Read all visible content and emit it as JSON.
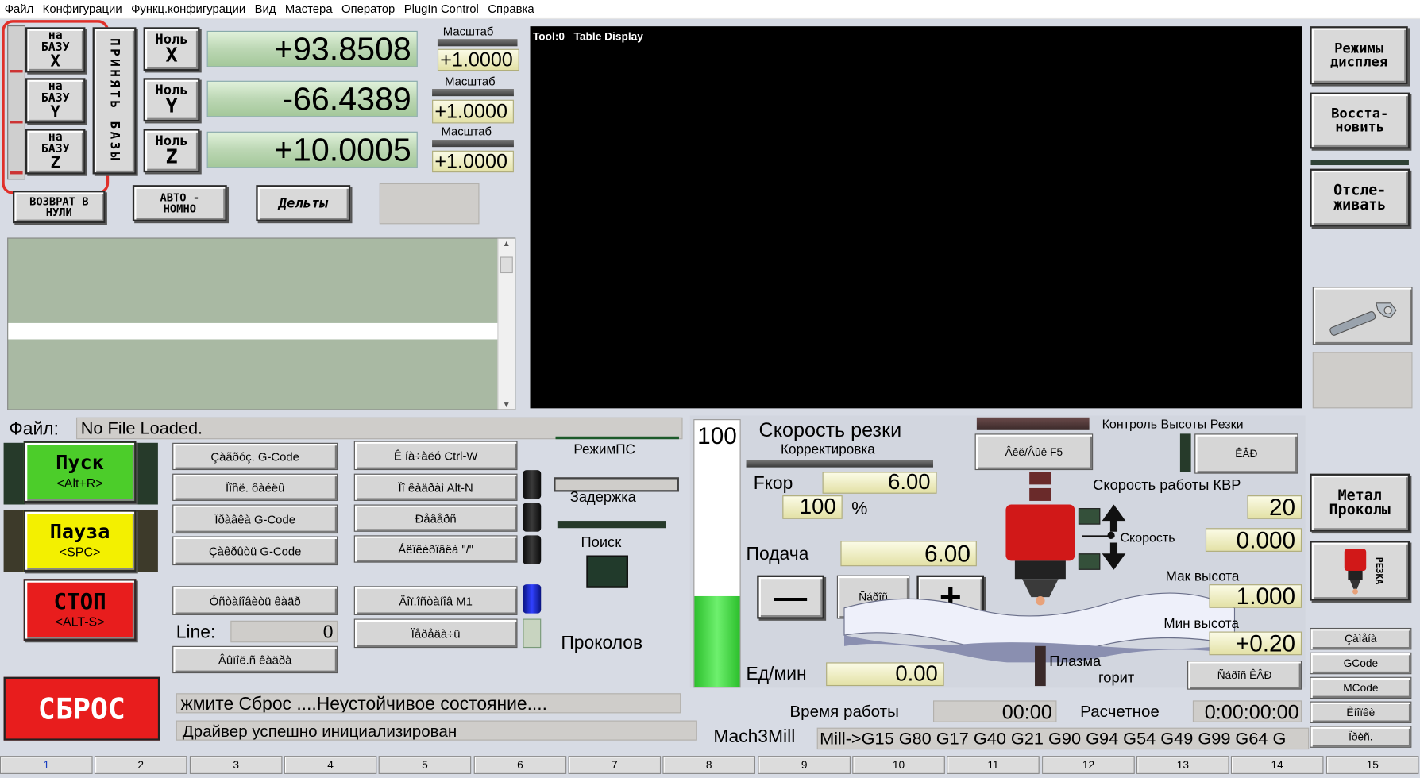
{
  "menu": [
    "Файл",
    "Конфигурации",
    "Функц.конфигурации",
    "Вид",
    "Мастера",
    "Оператор",
    "PlugIn Control",
    "Справка"
  ],
  "axes": [
    {
      "home_top": "на",
      "home_mid": "БАЗУ",
      "axis": "X",
      "zero_top": "Ноль",
      "value": "+93.8508",
      "scale_label": "Масштаб",
      "scale": "+1.0000"
    },
    {
      "home_top": "на",
      "home_mid": "БАЗУ",
      "axis": "Y",
      "zero_top": "Ноль",
      "value": "-66.4389",
      "scale_label": "Масштаб",
      "scale": "+1.0000"
    },
    {
      "home_top": "на",
      "home_mid": "БАЗУ",
      "axis": "Z",
      "zero_top": "Ноль",
      "value": "+10.0005",
      "scale_label": "Масштаб",
      "scale": "+1.0000"
    }
  ],
  "ref_all_vertical": "ПРИНЯТЬ БАЗЫ",
  "goto_zero": "ВОЗВРАТ В НУЛИ",
  "auto": "АВТО - НОМНО",
  "deltas": "Дельты",
  "toolpath": {
    "tool": "Tool:0",
    "title": "Table Display"
  },
  "right_buttons": {
    "display_modes": "Режимы дисплея",
    "restore": "Восста- новить",
    "track": "Отсле- живать",
    "metal": "Метал Проколы",
    "cut_vertical": "РЕЗКА"
  },
  "file": {
    "label": "Файл:",
    "value": "No File Loaded."
  },
  "cycle": {
    "start": "Пуск",
    "start_key": "<Alt+R>",
    "pause": "Пауза",
    "pause_key": "<SPC>",
    "stop": "СТОП",
    "stop_key": "<ALT-S>",
    "reset": "СБРОС"
  },
  "gcode_buttons": [
    "Çàãðóç. G-Code",
    "Ïîñë. ôàéëû",
    "Ïðàâêà G-Code",
    "Çàêðûòü G-Code",
    "Óñòàíîâèòü êàäð",
    "Âûïîë.ñ êàäðà"
  ],
  "mid_buttons": [
    "Ê íà÷àëó Ctrl-W",
    "Ïî êàäðàì Alt-N",
    "Ðåâåðñ",
    "Áëîêèðîâêà \"/\"",
    "Äîï.îñòàíîâ M1",
    "Ïåðåäà÷ü"
  ],
  "line": {
    "label": "Line:",
    "value": "0"
  },
  "mode_ps": "РежимПС",
  "delay": "Задержка",
  "search": "Поиск",
  "punches": "Проколов",
  "feed": {
    "gauge": "100",
    "title": "Скорость резки",
    "correction": "Корректировка",
    "fkor_label": "Fкор",
    "fkor": "6.00",
    "percent": "100",
    "percent_sign": "%",
    "feed_label": "Подача",
    "feed": "6.00",
    "units_label": "Ед/мин",
    "units": "0.00",
    "minus": "—",
    "reset_btn": "Ñáðîñ",
    "plus": "+",
    "progress_percent": 100
  },
  "thc": {
    "title": "Контроль Высоты Резки",
    "on_off": "Âêë/Âûê F5",
    "thc_btn": "ÊÂÐ",
    "speed_label": "Скорость работы КВР",
    "speed": "20",
    "speed2_label": "Скорость",
    "speed2": "0.000",
    "max_label": "Мак высота",
    "max": "1.000",
    "min_label": "Мин высота",
    "min": "+0.20",
    "plasma": "Плазма",
    "burns": "горит",
    "reset_thc": "Ñáðîñ ÊÂÐ"
  },
  "side_small": [
    "Çàìåíà",
    "GCode",
    "MCode",
    "Êíîïêè",
    "Ïðèñ."
  ],
  "status": {
    "error": "жмите Сброс ....Неустойчивое состояние....",
    "info": "Драйвер успешно инициализирован"
  },
  "runtime": {
    "label": "Время работы",
    "value": "00:00",
    "est_label": "Расчетное",
    "est": "0:00:00:00"
  },
  "profile": {
    "name": "Mach3Mill",
    "modal": "Mill->G15  G80 G17 G40 G21 G90 G94 G54 G49 G99 G64 G"
  },
  "tabs": [
    "1",
    "2",
    "3",
    "4",
    "5",
    "6",
    "7",
    "8",
    "9",
    "10",
    "11",
    "12",
    "13",
    "14",
    "15"
  ],
  "colors": {
    "start": "#4ccd2a",
    "pause": "#f3f000",
    "stop": "#e81d1d",
    "highlight": "#e0302a"
  }
}
